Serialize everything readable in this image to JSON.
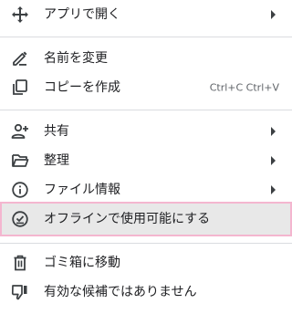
{
  "menu": {
    "items": [
      {
        "icon": "move-arrows-icon",
        "label": "アプリで開く",
        "has_submenu": true
      },
      {
        "icon": "pencil-icon",
        "label": "名前を変更",
        "has_submenu": false
      },
      {
        "icon": "copy-icon",
        "label": "コピーを作成",
        "shortcut": "Ctrl+C Ctrl+V",
        "has_submenu": false
      },
      {
        "icon": "person-add-icon",
        "label": "共有",
        "has_submenu": true
      },
      {
        "icon": "folder-open-icon",
        "label": "整理",
        "has_submenu": true
      },
      {
        "icon": "info-icon",
        "label": "ファイル情報",
        "has_submenu": true
      },
      {
        "icon": "offline-check-icon",
        "label": "オフラインで使用可能にする",
        "has_submenu": false,
        "highlighted": true
      },
      {
        "icon": "trash-icon",
        "label": "ゴミ箱に移動",
        "has_submenu": false
      },
      {
        "icon": "thumb-down-icon",
        "label": "有効な候補ではありません",
        "has_submenu": false
      }
    ]
  },
  "colors": {
    "text": "#202124",
    "shortcut": "#5f6368",
    "icon": "#3c4043",
    "divider": "#dadce0",
    "highlight_bg": "#e8e8e8",
    "highlight_border": "#f4b6cf"
  }
}
